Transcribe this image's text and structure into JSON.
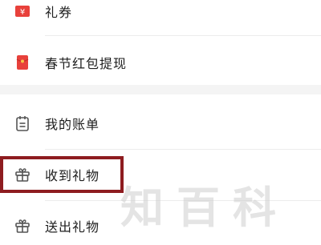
{
  "menu": {
    "items": [
      {
        "label": "礼券",
        "icon": "coupon-icon"
      },
      {
        "label": "春节红包提现",
        "icon": "red-envelope-icon"
      },
      {
        "label": "我的账单",
        "icon": "bill-icon"
      },
      {
        "label": "收到礼物",
        "icon": "gift-icon"
      },
      {
        "label": "送出礼物",
        "icon": "gift-icon"
      }
    ]
  },
  "highlight": {
    "target": "收到礼物",
    "color": "#8e1c20"
  },
  "watermark": {
    "chars": [
      "知",
      "百",
      "科"
    ]
  },
  "colors": {
    "accent_red": "#e8413b",
    "icon_gray": "#555555",
    "text": "#1e1e1e"
  }
}
